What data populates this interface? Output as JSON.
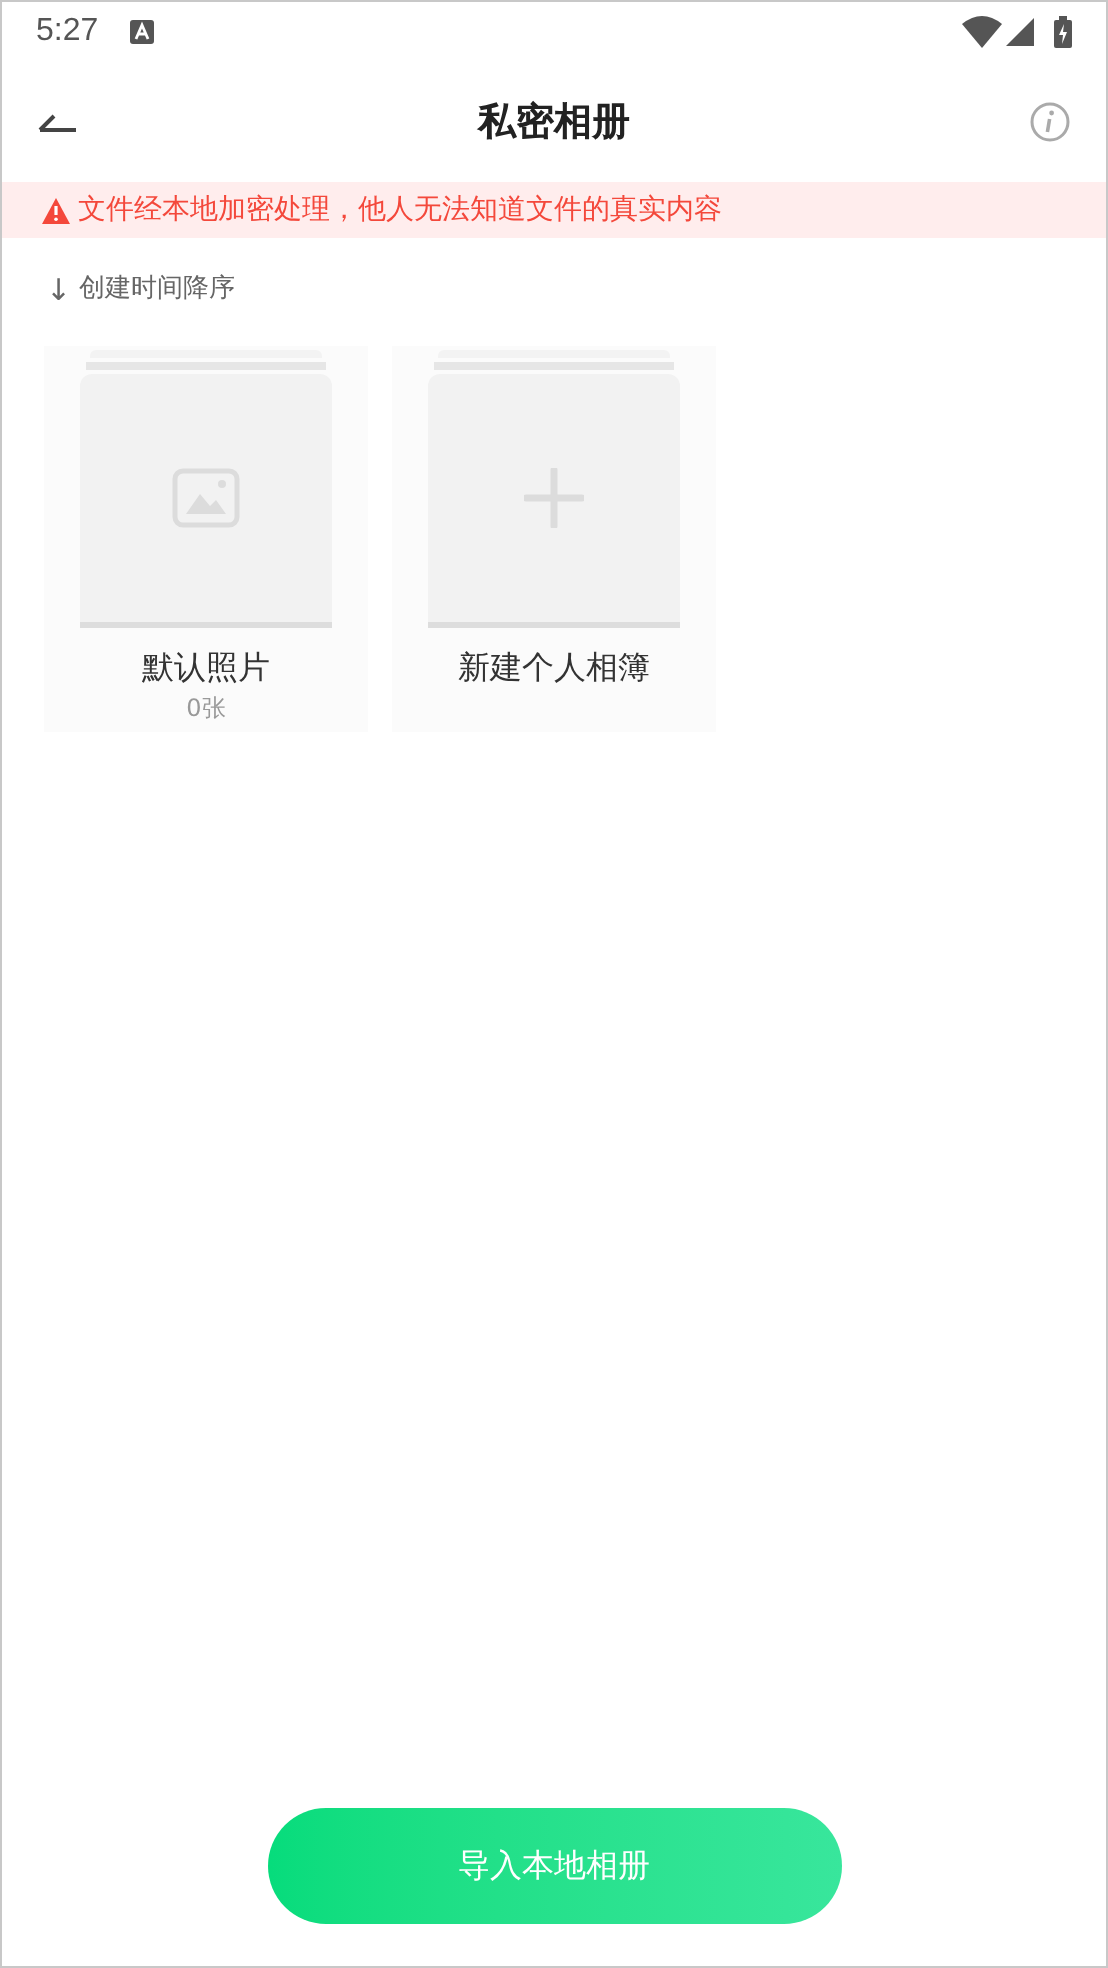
{
  "status_bar": {
    "time": "5:27"
  },
  "header": {
    "title": "私密相册"
  },
  "notice": {
    "text": "文件经本地加密处理，他人无法知道文件的真实内容"
  },
  "sort": {
    "arrow": "↓",
    "label": "创建时间降序"
  },
  "albums": [
    {
      "kind": "photo",
      "name": "默认照片",
      "count": "0张"
    },
    {
      "kind": "new",
      "name": "新建个人相簿"
    }
  ],
  "import_button": {
    "label": "导入本地相册"
  }
}
